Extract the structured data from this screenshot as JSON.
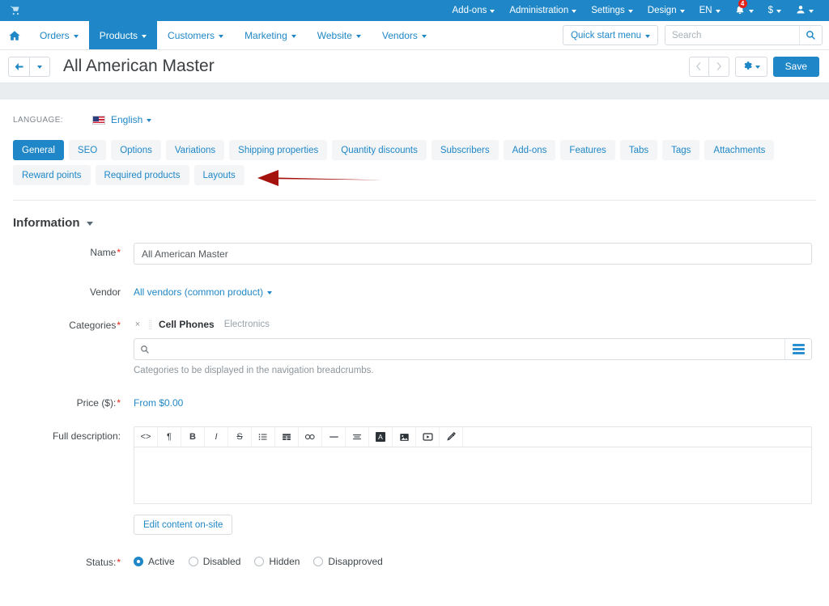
{
  "topbar": {
    "cart_icon": "cart-icon",
    "items": [
      {
        "label": "Add-ons",
        "icon": "chevron-down-icon"
      },
      {
        "label": "Administration",
        "icon": "chevron-down-icon"
      },
      {
        "label": "Settings",
        "icon": "chevron-down-icon"
      },
      {
        "label": "Design",
        "icon": "chevron-down-icon"
      },
      {
        "label": "EN",
        "icon": "chevron-down-icon"
      }
    ],
    "notifications": {
      "icon": "bell-icon",
      "count": "4"
    },
    "currency": {
      "label": "$",
      "icon": "chevron-down-icon"
    },
    "account": {
      "icon": "user-icon"
    },
    "background_color": "#1f87c7"
  },
  "navbar": {
    "home_icon": "home-icon",
    "items": [
      {
        "label": "Orders",
        "active": false
      },
      {
        "label": "Products",
        "active": true
      },
      {
        "label": "Customers",
        "active": false
      },
      {
        "label": "Marketing",
        "active": false
      },
      {
        "label": "Website",
        "active": false
      },
      {
        "label": "Vendors",
        "active": false
      }
    ],
    "quick_start": {
      "label": "Quick start menu",
      "icon": "chevron-down-icon"
    },
    "search": {
      "placeholder": "Search",
      "value": "",
      "icon": "search-icon"
    }
  },
  "titlebar": {
    "back_icon": "arrow-left-icon",
    "back_dropdown_icon": "chevron-down-icon",
    "title": "All American Master",
    "prev_icon": "chevron-left-icon",
    "next_icon": "chevron-right-icon",
    "gear_icon": "gear-icon",
    "gear_dropdown_icon": "chevron-down-icon",
    "save_label": "Save",
    "accent_color": "#1f87c7"
  },
  "language": {
    "label": "LANGUAGE:",
    "flag_icon": "us-flag-icon",
    "selected": "English",
    "dropdown_icon": "chevron-down-icon"
  },
  "tabs": [
    {
      "label": "General",
      "active": true
    },
    {
      "label": "SEO",
      "active": false
    },
    {
      "label": "Options",
      "active": false
    },
    {
      "label": "Variations",
      "active": false
    },
    {
      "label": "Shipping properties",
      "active": false
    },
    {
      "label": "Quantity discounts",
      "active": false
    },
    {
      "label": "Subscribers",
      "active": false
    },
    {
      "label": "Add-ons",
      "active": false
    },
    {
      "label": "Features",
      "active": false
    },
    {
      "label": "Tabs",
      "active": false
    },
    {
      "label": "Tags",
      "active": false
    },
    {
      "label": "Attachments",
      "active": false
    },
    {
      "label": "Reward points",
      "active": false
    },
    {
      "label": "Required products",
      "active": false
    },
    {
      "label": "Layouts",
      "active": false
    }
  ],
  "section": {
    "title": "Information",
    "collapse_icon": "caret-down-icon"
  },
  "form": {
    "name": {
      "label": "Name",
      "required": "*",
      "value": "All American Master",
      "placeholder": ""
    },
    "vendor": {
      "label": "Vendor",
      "value": "All vendors (common product)",
      "dropdown_icon": "chevron-down-icon"
    },
    "categories": {
      "label": "Categories",
      "required": "*",
      "chips": [
        {
          "remove_icon": "close-icon",
          "drag_icon": "drag-handle-icon",
          "name": "Cell Phones",
          "parent": "Electronics"
        }
      ],
      "search_placeholder": "",
      "search_value": "",
      "search_icon": "search-icon",
      "list_icon": "list-icon",
      "help_text": "Categories to be displayed in the navigation breadcrumbs."
    },
    "price": {
      "label": "Price ($):",
      "required": "*",
      "value": "From $0.00"
    },
    "full_description": {
      "label": "Full description:",
      "value": "",
      "toolbar": [
        {
          "name": "source-code-icon",
          "glyph": "<>"
        },
        {
          "name": "paragraph-icon",
          "glyph": "¶"
        },
        {
          "name": "bold-icon",
          "glyph": "B"
        },
        {
          "name": "italic-icon",
          "glyph": "I"
        },
        {
          "name": "strikethrough-icon",
          "glyph": "S"
        },
        {
          "name": "unordered-list-icon",
          "glyph": "☰"
        },
        {
          "name": "table-icon",
          "glyph": "▦"
        },
        {
          "name": "link-icon",
          "glyph": "∞"
        },
        {
          "name": "horizontal-rule-icon",
          "glyph": "—"
        },
        {
          "name": "align-icon",
          "glyph": "≡"
        },
        {
          "name": "font-color-icon",
          "glyph": "A"
        },
        {
          "name": "insert-image-icon",
          "glyph": "▣"
        },
        {
          "name": "insert-video-icon",
          "glyph": "▶"
        },
        {
          "name": "clear-format-icon",
          "glyph": "✓"
        }
      ],
      "edit_onsite_label": "Edit content on-site"
    },
    "status": {
      "label": "Status:",
      "required": "*",
      "options": [
        {
          "label": "Active",
          "checked": true
        },
        {
          "label": "Disabled",
          "checked": false
        },
        {
          "label": "Hidden",
          "checked": false
        },
        {
          "label": "Disapproved",
          "checked": false
        }
      ]
    }
  },
  "annotation": {
    "type": "arrow",
    "direction": "left",
    "color": "#a5130e",
    "points_at": "vendor-dropdown"
  }
}
